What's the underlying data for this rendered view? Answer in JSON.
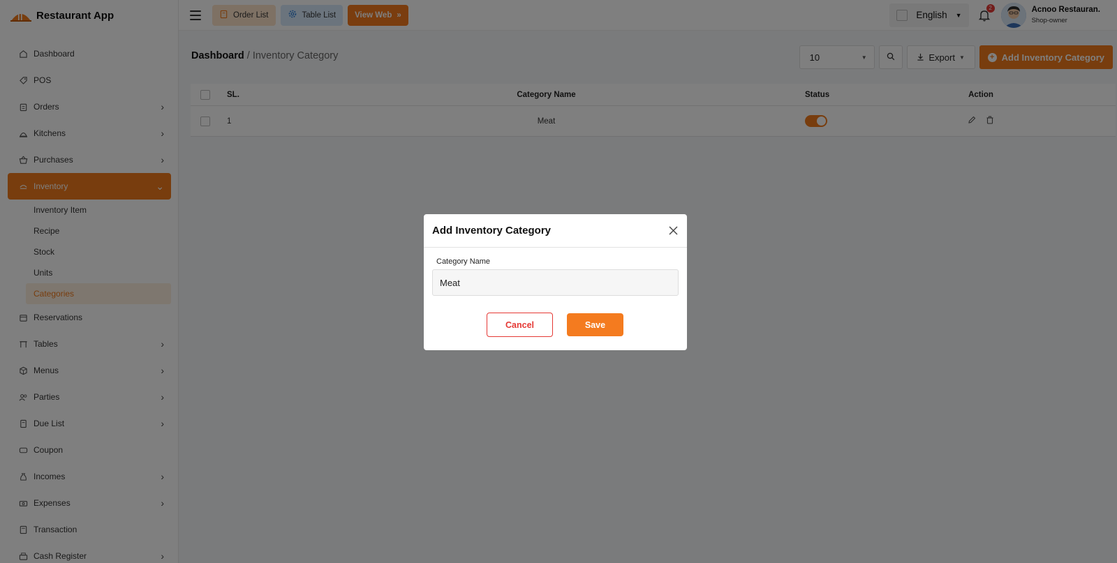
{
  "app": {
    "brand_name": "Restaurant App"
  },
  "topbar": {
    "order_list_label": "Order List",
    "table_list_label": "Table List",
    "view_web_label": "View Web",
    "language": "English",
    "notification_count": "2",
    "user_name": "Acnoo Restauran.",
    "user_role": "Shop-owner"
  },
  "sidebar": {
    "items": [
      {
        "label": "Dashboard",
        "icon": "home-icon",
        "has_children": false
      },
      {
        "label": "POS",
        "icon": "tag-icon",
        "has_children": false
      },
      {
        "label": "Orders",
        "icon": "clipboard-icon",
        "has_children": true
      },
      {
        "label": "Kitchens",
        "icon": "cloche-icon",
        "has_children": true
      },
      {
        "label": "Purchases",
        "icon": "basket-icon",
        "has_children": true
      },
      {
        "label": "Inventory",
        "icon": "inventory-icon",
        "has_children": true,
        "expanded": true
      }
    ],
    "inventory_sub": [
      {
        "label": "Inventory Item"
      },
      {
        "label": "Recipe"
      },
      {
        "label": "Stock"
      },
      {
        "label": "Units"
      },
      {
        "label": "Categories",
        "active": true
      }
    ],
    "items_after": [
      {
        "label": "Reservations",
        "icon": "calendar-icon",
        "has_children": false
      },
      {
        "label": "Tables",
        "icon": "table-icon",
        "has_children": true
      },
      {
        "label": "Menus",
        "icon": "box-icon",
        "has_children": true
      },
      {
        "label": "Parties",
        "icon": "users-icon",
        "has_children": true
      },
      {
        "label": "Due List",
        "icon": "receipt-icon",
        "has_children": true
      },
      {
        "label": "Coupon",
        "icon": "ticket-icon",
        "has_children": false
      },
      {
        "label": "Incomes",
        "icon": "money-bag-icon",
        "has_children": true
      },
      {
        "label": "Expenses",
        "icon": "cash-icon",
        "has_children": true
      },
      {
        "label": "Transaction",
        "icon": "calculator-icon",
        "has_children": false
      },
      {
        "label": "Cash Register",
        "icon": "register-icon",
        "has_children": true
      }
    ]
  },
  "page": {
    "breadcrumb_home": "Dashboard",
    "breadcrumb_sep": " / ",
    "breadcrumb_current": "Inventory Category",
    "per_page": "10",
    "export_label": "Export",
    "add_button_label": "Add Inventory Category"
  },
  "table": {
    "headers": {
      "sl": "SL.",
      "name": "Category Name",
      "status": "Status",
      "action": "Action"
    },
    "rows": [
      {
        "sl": "1",
        "name": "Meat",
        "status_on": true
      }
    ]
  },
  "modal": {
    "title": "Add Inventory Category",
    "field_label": "Category Name",
    "field_value": "Meat",
    "cancel_label": "Cancel",
    "save_label": "Save"
  },
  "colors": {
    "accent": "#f07b1d",
    "danger": "#e53935"
  }
}
